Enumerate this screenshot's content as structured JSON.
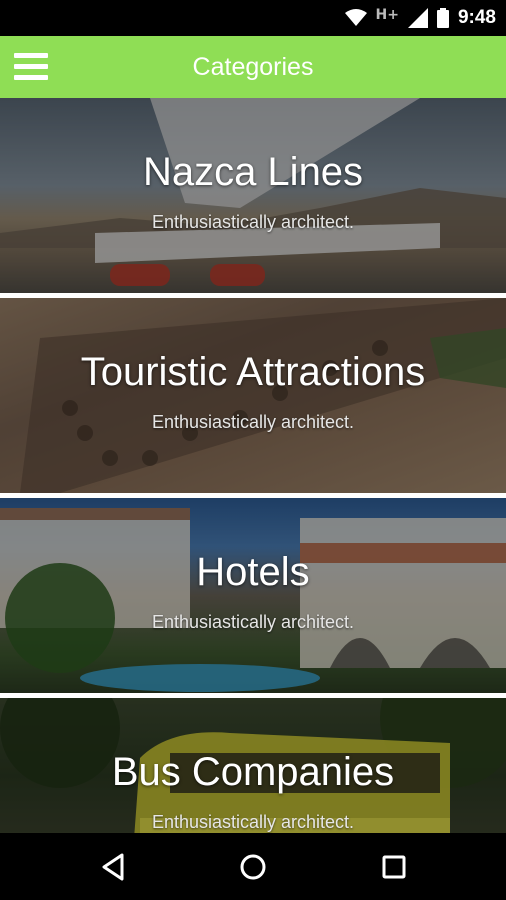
{
  "status_bar": {
    "network": "H+",
    "time": "9:48",
    "icons": [
      "wifi-icon",
      "signal-icon",
      "battery-icon"
    ]
  },
  "app_bar": {
    "title": "Categories",
    "menu_icon": "hamburger-menu-icon",
    "color": "#8fde55"
  },
  "categories": [
    {
      "title": "Nazca Lines",
      "subtitle": "Enthusiastically architect."
    },
    {
      "title": "Touristic Attractions",
      "subtitle": "Enthusiastically architect."
    },
    {
      "title": "Hotels",
      "subtitle": "Enthusiastically architect."
    },
    {
      "title": "Bus Companies",
      "subtitle": "Enthusiastically architect."
    }
  ],
  "nav_bar": {
    "buttons": [
      "back-icon",
      "home-icon",
      "recents-icon"
    ]
  }
}
